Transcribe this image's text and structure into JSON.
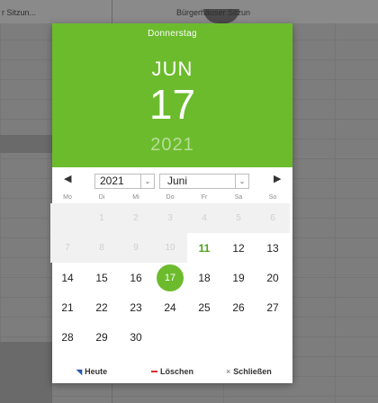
{
  "background": {
    "label_left": "r Sitzun...",
    "label_right": "Bürgerhäuser Sitzun"
  },
  "header": {
    "weekday": "Donnerstag",
    "month": "JUN",
    "day": "17",
    "year": "2021"
  },
  "nav": {
    "prev": "◀",
    "next": "▶",
    "year_value": "2021",
    "month_value": "Juni",
    "dropdown_glyph": "⌄"
  },
  "weekdays": [
    "Mo",
    "Di",
    "Mi",
    "Do",
    "Fr",
    "Sa",
    "So"
  ],
  "weeks": [
    [
      {
        "t": "",
        "k": "empty"
      },
      {
        "t": "1",
        "k": "out"
      },
      {
        "t": "2",
        "k": "out"
      },
      {
        "t": "3",
        "k": "out"
      },
      {
        "t": "4",
        "k": "out"
      },
      {
        "t": "5",
        "k": "out"
      },
      {
        "t": "6",
        "k": "out"
      }
    ],
    [
      {
        "t": "7",
        "k": "out"
      },
      {
        "t": "8",
        "k": "out"
      },
      {
        "t": "9",
        "k": "out"
      },
      {
        "t": "10",
        "k": "out"
      },
      {
        "t": "11",
        "k": "today"
      },
      {
        "t": "12",
        "k": ""
      },
      {
        "t": "13",
        "k": ""
      }
    ],
    [
      {
        "t": "14",
        "k": ""
      },
      {
        "t": "15",
        "k": ""
      },
      {
        "t": "16",
        "k": ""
      },
      {
        "t": "17",
        "k": "selected"
      },
      {
        "t": "18",
        "k": ""
      },
      {
        "t": "19",
        "k": ""
      },
      {
        "t": "20",
        "k": ""
      }
    ],
    [
      {
        "t": "21",
        "k": ""
      },
      {
        "t": "22",
        "k": ""
      },
      {
        "t": "23",
        "k": ""
      },
      {
        "t": "24",
        "k": ""
      },
      {
        "t": "25",
        "k": ""
      },
      {
        "t": "26",
        "k": ""
      },
      {
        "t": "27",
        "k": ""
      }
    ],
    [
      {
        "t": "28",
        "k": ""
      },
      {
        "t": "29",
        "k": ""
      },
      {
        "t": "30",
        "k": ""
      },
      {
        "t": "",
        "k": "blank"
      },
      {
        "t": "",
        "k": "blank"
      },
      {
        "t": "",
        "k": "blank"
      },
      {
        "t": "",
        "k": "blank"
      }
    ]
  ],
  "footer": {
    "today_label": "Heute",
    "clear_label": "Löschen",
    "close_label": "Schließen",
    "today_icon": "◥",
    "close_icon": "×"
  },
  "colors": {
    "accent": "#6cbb2d",
    "today_text": "#4ea41c",
    "clear": "#d62b2b",
    "today_icon": "#2857a8"
  }
}
